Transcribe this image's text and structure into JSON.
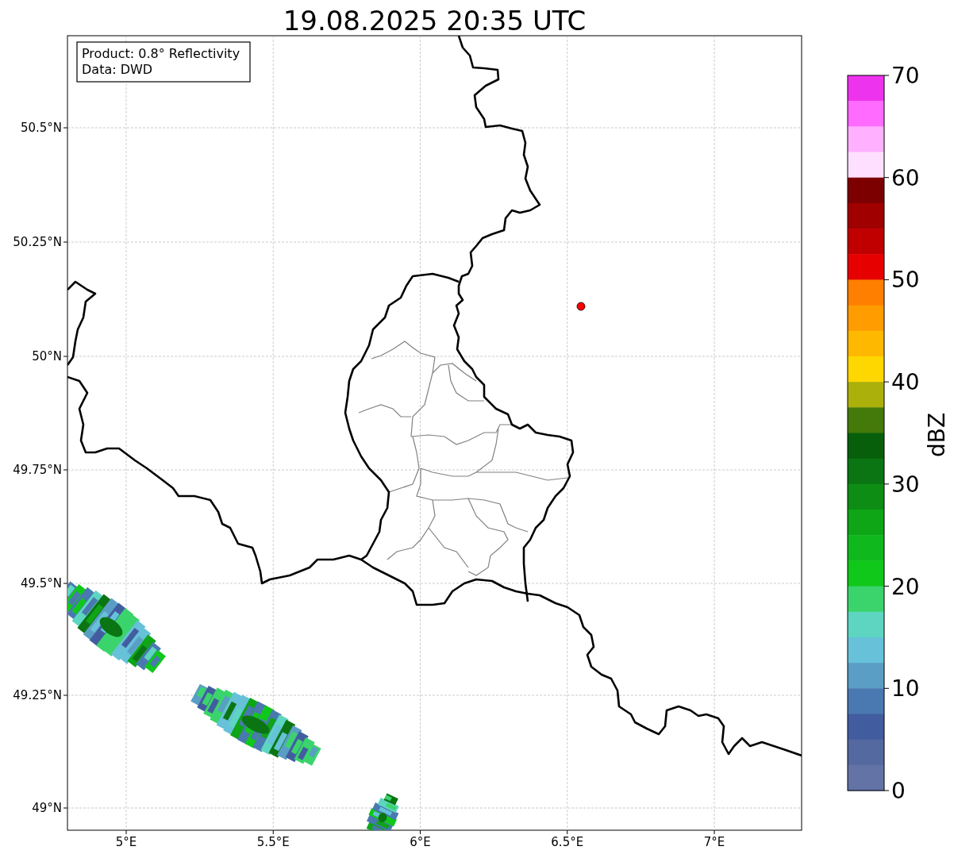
{
  "title": "19.08.2025 20:35 UTC",
  "info_box": {
    "lines": [
      "Product: 0.8° Reflectivity",
      "Data: DWD"
    ]
  },
  "x_ticks": [
    "5°E",
    "5.5°E",
    "6°E",
    "6.5°E",
    "7°E"
  ],
  "y_ticks": [
    "50.5°N",
    "50.25°N",
    "50°N",
    "49.75°N",
    "49.5°N",
    "49.25°N",
    "49°N"
  ],
  "colorbar": {
    "label": "dBZ",
    "ticks": [
      "70",
      "60",
      "50",
      "40",
      "30",
      "20",
      "10",
      "0"
    ],
    "segments": [
      {
        "color": "#ee33ee"
      },
      {
        "color": "#ff6aff"
      },
      {
        "color": "#ffb0ff"
      },
      {
        "color": "#ffdfff"
      },
      {
        "color": "#7c0000"
      },
      {
        "color": "#a00000"
      },
      {
        "color": "#c00000"
      },
      {
        "color": "#e60000"
      },
      {
        "color": "#ff7f00"
      },
      {
        "color": "#ff9c00"
      },
      {
        "color": "#ffb800"
      },
      {
        "color": "#ffd700"
      },
      {
        "color": "#acb00a"
      },
      {
        "color": "#447a0a"
      },
      {
        "color": "#075f0c"
      },
      {
        "color": "#0a7512"
      },
      {
        "color": "#0d8d14"
      },
      {
        "color": "#0ea516"
      },
      {
        "color": "#0fb81c"
      },
      {
        "color": "#10c81a"
      },
      {
        "color": "#3bd46c"
      },
      {
        "color": "#5dd5c1"
      },
      {
        "color": "#66c1d9"
      },
      {
        "color": "#5a9ec5"
      },
      {
        "color": "#4a78b0"
      },
      {
        "color": "#425d9f"
      },
      {
        "color": "#5469a0"
      },
      {
        "color": "#6473a6"
      }
    ]
  }
}
